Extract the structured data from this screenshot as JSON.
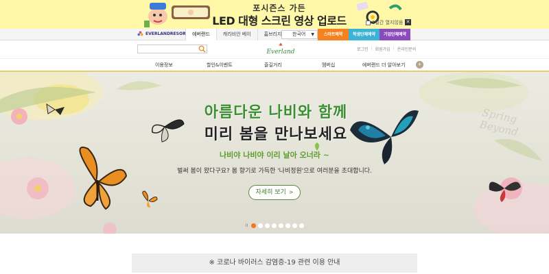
{
  "promo": {
    "title": "포시즌스 가든",
    "subtitle": "LED 대형 스크린 영상 업로드",
    "dismiss_label": "1일간 열지않음",
    "close_symbol": "✕"
  },
  "resort_bar": {
    "logo_text": "EVERLANDRESORT",
    "site_tabs": [
      {
        "label": "에버랜드",
        "active": true
      },
      {
        "label": "캐리비안 베이",
        "active": false
      },
      {
        "label": "홈브리지",
        "active": false
      }
    ],
    "language": "한국어",
    "booking_buttons": [
      {
        "label": "스마트예약",
        "color": "#f5821f"
      },
      {
        "label": "학생단체예약",
        "color": "#3cb3d6"
      },
      {
        "label": "기업단체예약",
        "color": "#8b4bbd"
      }
    ]
  },
  "header": {
    "search_placeholder": "",
    "logo_text": "Everland",
    "util_links": [
      "로그인",
      "회원가입",
      "온라인문의"
    ]
  },
  "gnb": {
    "items": [
      "이용정보",
      "할인&이벤트",
      "즐길거리",
      "멤버십",
      "에버랜드 더 알아보기"
    ],
    "more_symbol": "+",
    "accent": "#e9c96e"
  },
  "hero": {
    "title_line1": "아름다운 나비와 함께",
    "title_line2": "미리 봄을 만나보세요",
    "tagline": "나비야 나비야 이리 날아 오너라 ~",
    "description": "벌써 봄이 왔다구요? 봄 향기로 가득한 '나비정원'으로 여러분을 초대합니다.",
    "button_label": "자세히 보기",
    "button_arrow": ">",
    "spring_text": "Spring Beyond",
    "slides_total": 8,
    "slide_active": 1,
    "pause_symbol": "II"
  },
  "notice": {
    "text": "※ 코로나 바이러스 감염증-19 관련 이용 안내"
  }
}
